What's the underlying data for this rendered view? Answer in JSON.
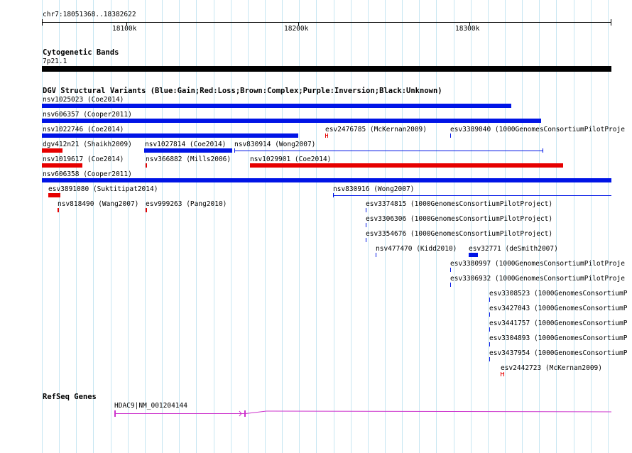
{
  "ruler": {
    "location": "chr7:18051368..18382622",
    "labels": [
      "18100k",
      "18200k",
      "18300k"
    ]
  },
  "cytoband": {
    "title": "Cytogenetic Bands",
    "band": "7p21.1"
  },
  "dgv": {
    "title": "DGV Structural Variants (Blue:Gain;Red:Loss;Brown:Complex;Purple:Inversion;Black:Unknown)",
    "colors": {
      "gain": "#0014e6",
      "loss": "#e60000"
    },
    "variants": [
      "nsv1025023 (Coe2014)",
      "nsv606357 (Cooper2011)",
      "nsv1022746 (Coe2014)",
      "esv2476785 (McKernan2009)",
      "esv3389040 (1000GenomesConsortiumPilotProje",
      "dgv412n21 (Shaikh2009)",
      "nsv1027814 (Coe2014)",
      "nsv830914 (Wong2007)",
      "nsv1019617 (Coe2014)",
      "nsv366882 (Mills2006)",
      "nsv1029901 (Coe2014)",
      "nsv606358 (Cooper2011)",
      "esv3891080 (Suktitipat2014)",
      "nsv830916 (Wong2007)",
      "nsv818490 (Wang2007)",
      "esv999263 (Pang2010)",
      "esv3374815 (1000GenomesConsortiumPilotProject)",
      "esv3306306 (1000GenomesConsortiumPilotProject)",
      "esv3354676 (1000GenomesConsortiumPilotProject)",
      "nsv477470 (Kidd2010)",
      "esv32771 (deSmith2007)",
      "esv3380997 (1000GenomesConsortiumPilotProje",
      "esv3306932 (1000GenomesConsortiumPilotProje",
      "esv3308523 (1000GenomesConsortiumP",
      "esv3427043 (1000GenomesConsortiumP",
      "esv3441757 (1000GenomesConsortiumP",
      "esv3304893 (1000GenomesConsortiumP",
      "esv3437954 (1000GenomesConsortiumP",
      "esv2442723 (McKernan2009)"
    ]
  },
  "refseq": {
    "title": "RefSeq Genes",
    "gene_label": "HDAC9|NM_001204144",
    "color": "#cc33cc"
  }
}
